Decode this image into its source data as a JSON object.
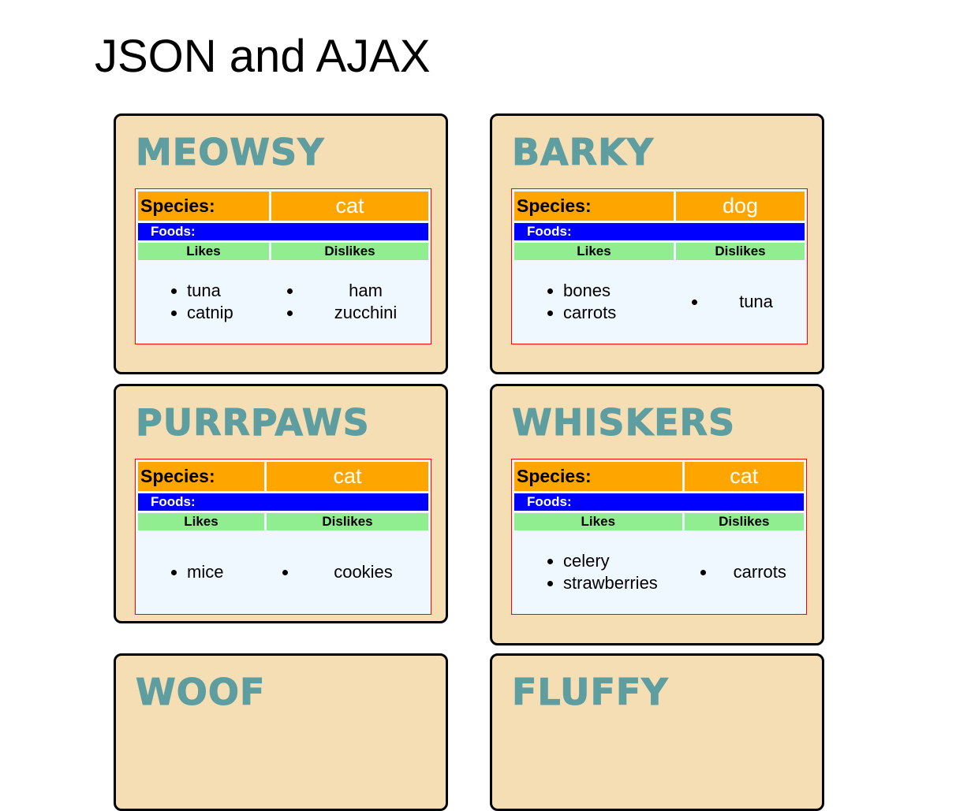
{
  "page": {
    "title": "JSON and AJAX"
  },
  "labels": {
    "species": "Species:",
    "foods": "Foods:",
    "likes": "Likes",
    "dislikes": "Dislikes"
  },
  "pets": [
    {
      "name": "Meowsy",
      "species": "cat",
      "likes": [
        "tuna",
        "catnip"
      ],
      "dislikes": [
        "ham",
        "zucchini"
      ]
    },
    {
      "name": "Barky",
      "species": "dog",
      "likes": [
        "bones",
        "carrots"
      ],
      "dislikes": [
        "tuna"
      ]
    },
    {
      "name": "Purrpaws",
      "species": "cat",
      "likes": [
        "mice"
      ],
      "dislikes": [
        "cookies"
      ]
    },
    {
      "name": "Whiskers",
      "species": "cat",
      "likes": [
        "celery",
        "strawberries"
      ],
      "dislikes": [
        "carrots"
      ]
    },
    {
      "name": "Woof",
      "species": "",
      "likes": [],
      "dislikes": []
    },
    {
      "name": "Fluffy",
      "species": "",
      "likes": [],
      "dislikes": []
    }
  ],
  "colors": {
    "card_bg": "#f5deb3",
    "name_color": "#5f9ea0",
    "species_bg": "#ffa500",
    "foods_bg": "#0000ff",
    "column_header_bg": "#90ee90",
    "table_bg": "#f0f8ff",
    "table_border": "#ff0000"
  }
}
